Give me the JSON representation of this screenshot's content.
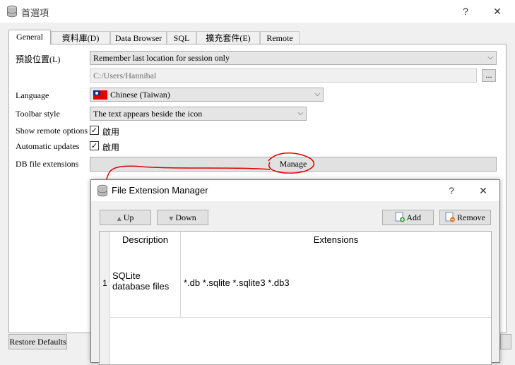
{
  "window": {
    "title": "首選項",
    "help_label": "?",
    "close_label": "✕"
  },
  "tabs": [
    {
      "label": "General"
    },
    {
      "label": "資料庫(D)"
    },
    {
      "label": "Data Browser"
    },
    {
      "label": "SQL"
    },
    {
      "label": "擴充套件(E)"
    },
    {
      "label": "Remote"
    }
  ],
  "general": {
    "default_location": {
      "label": "預設位置(L)",
      "value": "Remember last location for session only"
    },
    "location_path": {
      "value": "C:/Users/Hannibal",
      "browse_label": "..."
    },
    "language": {
      "label": "Language",
      "value": "Chinese (Taiwan)",
      "flag_icon": "taiwan-flag-icon"
    },
    "toolbar_style": {
      "label": "Toolbar style",
      "value": "The text appears beside the icon"
    },
    "show_remote": {
      "label": "Show remote options",
      "checkbox_label": "啟用",
      "checked": true
    },
    "auto_updates": {
      "label": "Automatic updates",
      "checkbox_label": "啟用",
      "checked": true
    },
    "db_extensions": {
      "label": "DB file extensions",
      "button_label": "Manage"
    }
  },
  "footer": {
    "restore_defaults_label": "Restore Defaults"
  },
  "dialog": {
    "title": "File Extension Manager",
    "help_label": "?",
    "close_label": "✕",
    "up_label": "Up",
    "down_label": "Down",
    "add_label": "Add",
    "remove_label": "Remove",
    "columns": [
      "Description",
      "Extensions"
    ],
    "rows": [
      {
        "index": "1",
        "description": "SQLite database files",
        "extensions": "*.db *.sqlite *.sqlite3 *.db3"
      }
    ]
  },
  "colors": {
    "annotation": "#e00000",
    "flag_red": "#e30000",
    "flag_blue": "#0b2c9a"
  }
}
